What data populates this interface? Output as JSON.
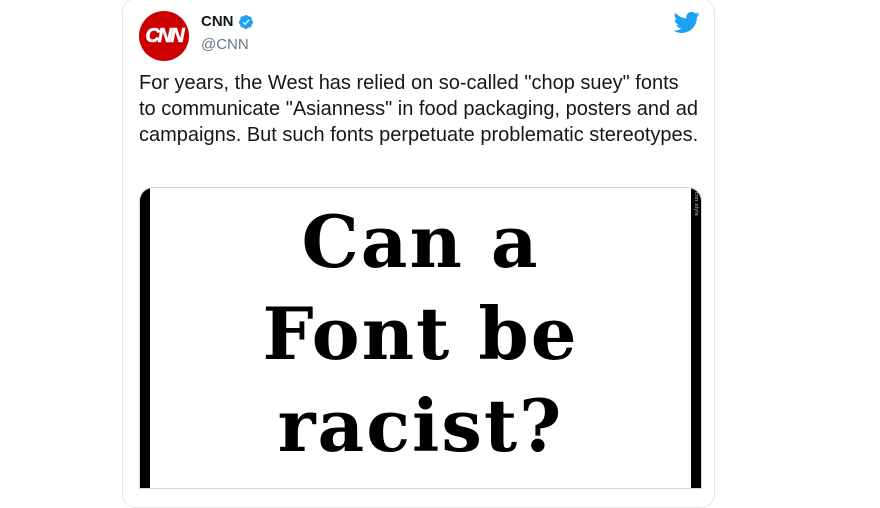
{
  "tweet": {
    "author_name": "CNN",
    "handle": "@CNN",
    "avatar_text": "CNN",
    "text": "For years, the West has relied on so-called \"chop suey\" fonts to communicate \"Asianness\" in food packaging, posters and ad campaigns. But such fonts perpetuate problematic stereotypes.",
    "verified": true
  },
  "media": {
    "headline_lines": [
      "Can a",
      "Font be",
      "racist?"
    ],
    "watermark": "cnn style"
  },
  "icons": {
    "avatar": "cnn-logo",
    "verified": "verified-badge-icon",
    "brand": "twitter-bird-icon"
  },
  "colors": {
    "avatar_bg": "#cc0000",
    "verified": "#1da1f2",
    "twitter_blue": "#1da1f2",
    "text": "#14171a",
    "handle": "#657786"
  }
}
